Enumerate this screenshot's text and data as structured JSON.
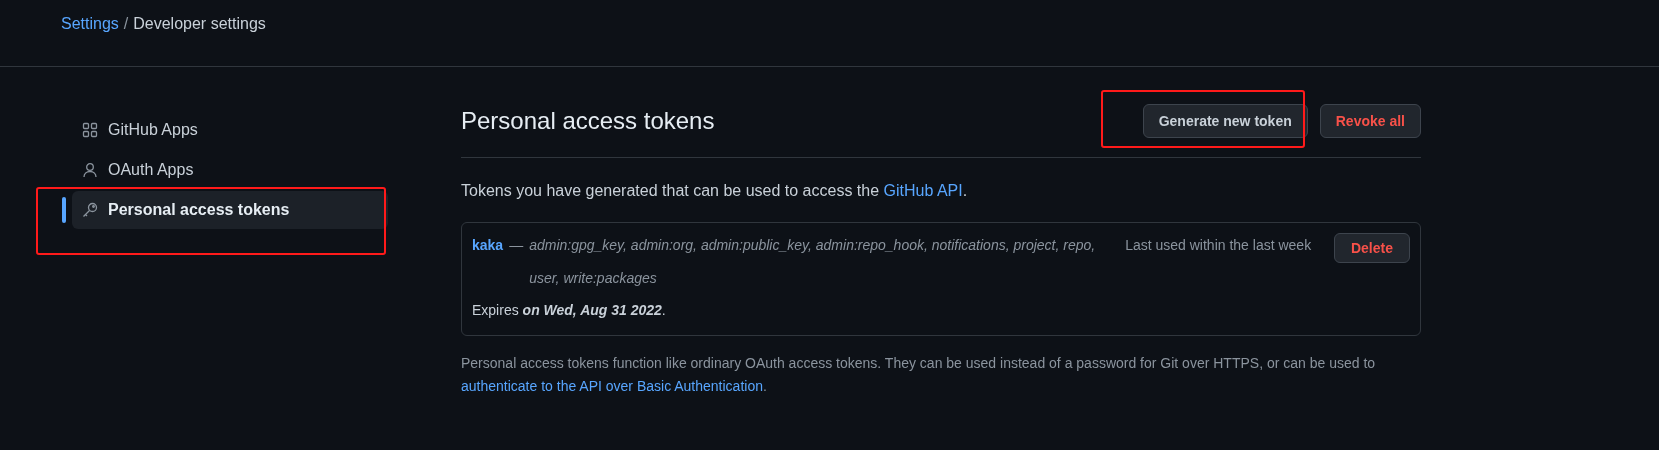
{
  "breadcrumb": [
    {
      "label": "Settings",
      "kind": "link"
    },
    {
      "label": "/",
      "kind": "separator"
    },
    {
      "label": "Developer settings",
      "kind": "current"
    }
  ],
  "sidebar": {
    "items": [
      {
        "label": "GitHub Apps",
        "kind": "apps",
        "selected": false,
        "highlighted": false
      },
      {
        "label": "OAuth Apps",
        "kind": "person",
        "selected": false,
        "highlighted": false
      },
      {
        "label": "Personal access tokens",
        "kind": "key",
        "selected": true,
        "highlighted": true
      }
    ]
  },
  "main": {
    "title": "Personal access tokens",
    "buttons": [
      {
        "label": "Generate new token",
        "kind": "default",
        "highlighted": true
      },
      {
        "label": "Revoke all",
        "kind": "danger",
        "highlighted": false
      }
    ],
    "intro": {
      "text": "Tokens you have generated that can be used to access the",
      "link": "GitHub API",
      "end": "."
    },
    "tokens": [
      {
        "name": "kaka",
        "dash": "—",
        "scopes": "admin:gpg_key, admin:org, admin:public_key, admin:repo_hook, notifications, project, repo, user, write:packages",
        "last_used": "Last used within the last week",
        "expires": "Expires **on Wed, Aug 31 2022**.",
        "action": "Delete"
      }
    ],
    "footer": {
      "text": "Personal access tokens function like ordinary OAuth access tokens. They can be used instead of a password for Git over HTTPS, or can be used to",
      "link": "authenticate to the API over Basic Authentication",
      "end": "."
    }
  }
}
